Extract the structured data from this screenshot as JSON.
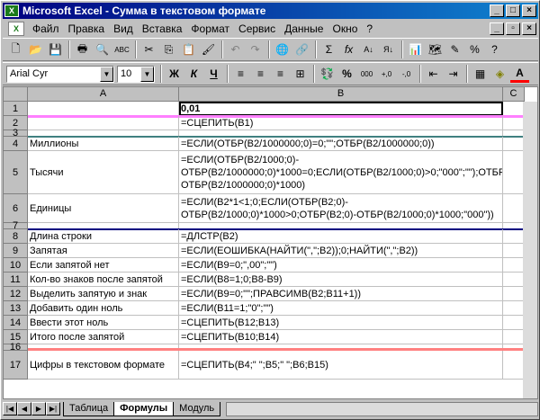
{
  "window": {
    "app_icon": "X",
    "title": "Microsoft Excel - Сумма в текстовом формате"
  },
  "title_buttons": [
    "_",
    "□",
    "×"
  ],
  "menu": {
    "doc_icon": "X",
    "items": [
      "Файл",
      "Правка",
      "Вид",
      "Вставка",
      "Формат",
      "Сервис",
      "Данные",
      "Окно",
      "?"
    ]
  },
  "doc_buttons": [
    "_",
    "▫",
    "×"
  ],
  "toolbar1": [
    "new-icon",
    "open-icon",
    "save-icon",
    "print-icon",
    "preview-icon",
    "spelling-icon",
    "cut-icon",
    "copy-icon",
    "paste-icon",
    "format-painter-icon",
    "undo-icon",
    "redo-icon",
    "hyperlink-icon",
    "web-icon",
    "autosum-icon",
    "function-icon",
    "sort-asc-icon",
    "sort-desc-icon",
    "chart-wizard-icon",
    "map-icon",
    "drawing-icon",
    "zoom-icon",
    "help-icon"
  ],
  "toolbar1_glyphs": [
    "🗋",
    "📂",
    "💾",
    "🖶",
    "🔍",
    "ABC",
    "✂",
    "⎘",
    "📋",
    "🖌",
    "↶",
    "↷",
    "🌐",
    "🔗",
    "Σ",
    "fx",
    "A↓",
    "Я↓",
    "📊",
    "🗺",
    "✎",
    "%",
    "?"
  ],
  "font": {
    "name": "Arial Cyr",
    "size": "10"
  },
  "format_buttons": [
    "Ж",
    "К",
    "Ч"
  ],
  "toolbar2_glyphs": [
    "≡",
    "≡",
    "≡",
    "⊞",
    "💱",
    "%",
    "000",
    "+,0",
    "-,0",
    "⇤",
    "⇥",
    "▦",
    "◈",
    "A"
  ],
  "columns": {
    "a": "A",
    "b": "B",
    "c": "C"
  },
  "rows": [
    {
      "n": "1",
      "a": "",
      "b": "0,01"
    },
    {
      "n": "2",
      "a": "",
      "b": "=СЦЕПИТЬ(B1)"
    },
    {
      "n": "3",
      "a": "",
      "b": ""
    },
    {
      "n": "4",
      "a": "Миллионы",
      "b": "=ЕСЛИ(ОТБР(B2/1000000;0)=0;\"\";ОТБР(B2/1000000;0))"
    },
    {
      "n": "5",
      "a": "Тысячи",
      "b": "=ЕСЛИ(ОТБР(B2/1000;0)-ОТБР(B2/1000000;0)*1000=0;ЕСЛИ(ОТБР(B2/1000;0)>0;\"000\";\"\");ОТБР(B2/1000;0)-ОТБР(B2/1000000;0)*1000)"
    },
    {
      "n": "6",
      "a": "Единицы",
      "b": "=ЕСЛИ(B2*1<1;0;ЕСЛИ(ОТБР(B2;0)-ОТБР(B2/1000;0)*1000>0;ОТБР(B2;0)-ОТБР(B2/1000;0)*1000;\"000\"))"
    },
    {
      "n": "7",
      "a": "",
      "b": ""
    },
    {
      "n": "8",
      "a": "Длина строки",
      "b": "=ДЛСТР(B2)"
    },
    {
      "n": "9",
      "a": "Запятая",
      "b": "=ЕСЛИ(ЕОШИБКА(НАЙТИ(\",\";B2));0;НАЙТИ(\",\";B2))"
    },
    {
      "n": "10",
      "a": "Если запятой нет",
      "b": "=ЕСЛИ(B9=0;\",00\";\"\")"
    },
    {
      "n": "11",
      "a": "Кол-во знаков после запятой",
      "b": "=ЕСЛИ(B8=1;0;B8-B9)"
    },
    {
      "n": "12",
      "a": "Выделить запятую и знак",
      "b": "=ЕСЛИ(B9=0;\"\";ПРАВСИМВ(B2;B11+1))"
    },
    {
      "n": "13",
      "a": "Добавить один ноль",
      "b": "=ЕСЛИ(B11=1;\"0\";\"\")"
    },
    {
      "n": "14",
      "a": "Ввести этот ноль",
      "b": "=СЦЕПИТЬ(B12;B13)"
    },
    {
      "n": "15",
      "a": "Итого после запятой",
      "b": "=СЦЕПИТЬ(B10;B14)"
    },
    {
      "n": "16",
      "a": "",
      "b": ""
    },
    {
      "n": "17",
      "a": "Цифры в текстовом формате",
      "b": "=СЦЕПИТЬ(B4;\" \";B5;\" \";B6;B15)"
    }
  ],
  "sheet_nav": [
    "|◀",
    "◀",
    "▶",
    "▶|"
  ],
  "tabs": [
    "Таблица",
    "Формулы",
    "Модуль"
  ],
  "separator_colors": {
    "magenta": "#ff80ff",
    "teal": "#408080",
    "navy": "#000080",
    "salmon": "#ff8080"
  }
}
